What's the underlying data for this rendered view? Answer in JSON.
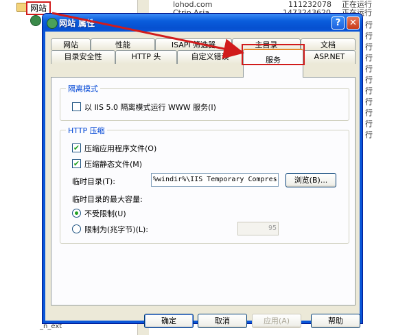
{
  "background": {
    "tree_label": "网站",
    "bottom_fragment": "_n_ext",
    "right_rows": [
      {
        "name": "lohod.com",
        "id": "111232078",
        "status": "正在运行"
      },
      {
        "name": "Ctrip Asia",
        "id": "1473243620",
        "status": "正在运行"
      },
      {
        "status": "行"
      },
      {
        "status": "行"
      },
      {
        "status": "行"
      },
      {
        "status": "行"
      },
      {
        "status": "行"
      },
      {
        "status": "行"
      },
      {
        "status": "行"
      },
      {
        "status": "行"
      },
      {
        "status": "行"
      },
      {
        "status": "行"
      },
      {
        "status": "行"
      }
    ]
  },
  "dialog": {
    "title": "网站 属性",
    "help_button": "?",
    "close_button": "✕",
    "tabs_row1": [
      "网站",
      "性能",
      "ISAPI 筛选器",
      "主目录",
      "文档"
    ],
    "tabs_row2": [
      "目录安全性",
      "HTTP 头",
      "自定义错误",
      "服务",
      "ASP.NET"
    ],
    "active_tab": "服务",
    "isolation": {
      "group_title": "隔离模式",
      "checkbox_label": "以 IIS 5.0 隔离模式运行 WWW 服务(I)",
      "checked": false
    },
    "compression": {
      "group_title": "HTTP 压缩",
      "compress_app_label": "压缩应用程序文件(O)",
      "compress_app_checked": true,
      "compress_static_label": "压缩静态文件(M)",
      "compress_static_checked": true,
      "temp_dir_label": "临时目录(T):",
      "temp_dir_value": "%windir%\\IIS Temporary Compres",
      "browse_button": "浏览(B)...",
      "max_size_label": "临时目录的最大容量:",
      "unlimited_label": "不受限制(U)",
      "unlimited_selected": true,
      "limit_label": "限制为(兆字节)(L):",
      "limit_selected": false,
      "limit_value": "95"
    },
    "buttons": {
      "ok": "确定",
      "cancel": "取消",
      "apply": "应用(A)",
      "help": "帮助"
    }
  },
  "colors": {
    "annotation_red": "#d11b1b",
    "titlebar_blue": "#0a56d8",
    "group_title_blue": "#0046d5",
    "check_green": "#21a121"
  }
}
